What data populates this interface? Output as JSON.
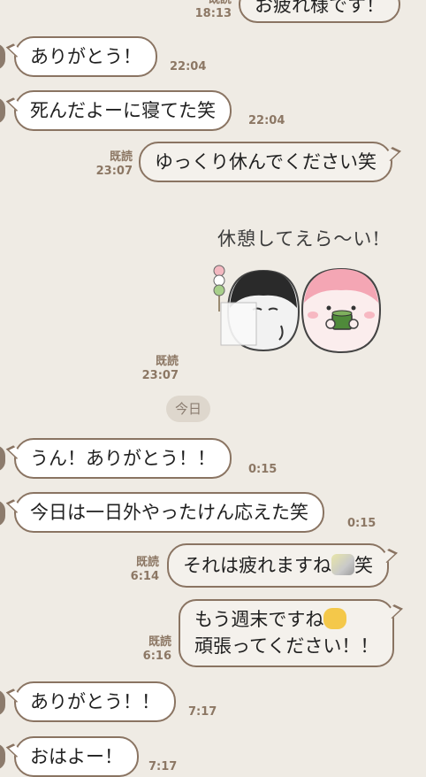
{
  "messages": [
    {
      "kind": "sent_top_partial",
      "text": "お疲れ様です！",
      "read": "既読",
      "time": "18:13"
    },
    {
      "kind": "received",
      "text": "ありがとう！",
      "time": "22:04"
    },
    {
      "kind": "received",
      "text": "死んだよーに寝てた笑",
      "time": "22:04"
    },
    {
      "kind": "sent",
      "text": "ゆっくり休んでください笑",
      "read": "既読",
      "time": "23:07"
    },
    {
      "kind": "sticker",
      "caption": "休憩してえら〜い!",
      "read": "既読",
      "time": "23:07"
    },
    {
      "kind": "received",
      "text": "うん！ありがとう！！",
      "time": "0:15"
    },
    {
      "kind": "received",
      "text": "今日は一日外やったけん応えた笑",
      "time": "0:15"
    },
    {
      "kind": "sent",
      "text_before": "それは疲れますね",
      "emoji": "tired-emoji",
      "text_after": "笑",
      "read": "既読",
      "time": "6:14"
    },
    {
      "kind": "sent",
      "line1": "もう週末ですね",
      "emoji": "cat-emoji",
      "line2": "頑張ってください！！",
      "read": "既読",
      "time": "6:16"
    },
    {
      "kind": "received",
      "text": "ありがとう！！",
      "time": "7:17"
    },
    {
      "kind": "received",
      "text": "おはよー！",
      "time": "7:17"
    }
  ],
  "date_divider": "今日",
  "colors": {
    "background": "#efebe4",
    "bubble_border": "#8a7462",
    "meta_text": "#8c7764",
    "date_chip": "#ded7cd"
  }
}
